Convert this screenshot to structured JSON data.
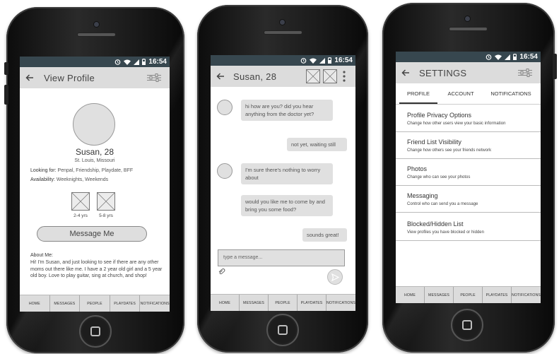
{
  "status": {
    "time": "16:54"
  },
  "nav_items": [
    "HOME",
    "MESSAGES",
    "PEOPLE",
    "PLAYDATES",
    "NOTIFICATIONS"
  ],
  "profile": {
    "title": "View Profile",
    "name": "Susan, 28",
    "location": "St. Louis, Missouri",
    "looking_for_label": "Looking for:",
    "looking_for_value": "Penpal, Friendship, Playdate, BFF",
    "availability_label": "Availability:",
    "availability_value": "Weeknights, Weekends",
    "kids": [
      "2-4 yrs",
      "5-8 yrs"
    ],
    "message_button": "Message Me",
    "about_label": "About Me:",
    "about_text": "Hi! I'm Susan, and just looking to see if there are any other moms out there like me.  I have a 2 year old girl and a 5 year old boy.  Love to play guitar, sing at church, and shop!"
  },
  "chat": {
    "title": "Susan, 28",
    "messages": [
      {
        "from": "them",
        "text": "hi how are you? did you hear anything from the doctor yet?"
      },
      {
        "from": "me",
        "text": "not yet, waiting still"
      },
      {
        "from": "them",
        "text": "I'm sure there's nothing to worry about"
      },
      {
        "from": "them",
        "text": "would you like me to come by and bring you some food?"
      },
      {
        "from": "me",
        "text": "sounds great!"
      }
    ],
    "input_placeholder": "type a message..."
  },
  "settings": {
    "title": "SETTINGS",
    "tabs": [
      "PROFILE",
      "ACCOUNT",
      "NOTIFICATIONS"
    ],
    "items": [
      {
        "title": "Profile Privacy Options",
        "desc": "Change how other users view your basic information"
      },
      {
        "title": "Friend List Visibility",
        "desc": "Change how others see your friends network"
      },
      {
        "title": "Photos",
        "desc": "Change who can see your photos"
      },
      {
        "title": "Messaging",
        "desc": "Control who can send you a message"
      },
      {
        "title": "Blocked/Hidden List",
        "desc": "View profiles you have blocked or hidden"
      }
    ]
  },
  "colors": {
    "statusbar": "#37474f",
    "appbar": "#dcdcdc",
    "bubble": "#e0e0e0"
  },
  "icons": [
    "back-arrow-icon",
    "sliders-icon",
    "alarm-icon",
    "wifi-icon",
    "signal-icon",
    "battery-icon",
    "more-vert-icon",
    "attach-icon",
    "send-icon",
    "image-placeholder-icon"
  ]
}
